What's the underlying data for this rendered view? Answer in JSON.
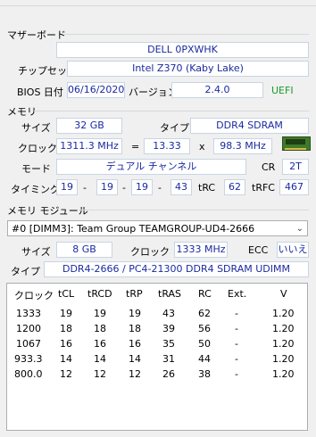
{
  "motherboard": {
    "title": "マザーボード",
    "model": "DELL 0PXWHK",
    "chipset_label": "チップセット",
    "chipset": "Intel Z370 (Kaby Lake)",
    "bios_label": "BIOS 日付",
    "bios_date": "06/16/2020",
    "version_label": "バージョン",
    "version": "2.4.0",
    "uefi": "UEFI"
  },
  "memory": {
    "title": "メモリ",
    "size_label": "サイズ",
    "size": "32 GB",
    "type_label": "タイプ",
    "type": "DDR4 SDRAM",
    "clock_label": "クロック",
    "clock": "1311.3 MHz",
    "eq": "=",
    "multiplier": "13.33",
    "x": "x",
    "bus": "98.3 MHz",
    "mode_label": "モード",
    "mode": "デュアル チャンネル",
    "cr_label": "CR",
    "cr": "2T",
    "timing_label": "タイミング",
    "t1": "19",
    "t2": "19",
    "t3": "19",
    "t4": "43",
    "dash": "-",
    "trc_label": "tRC",
    "trc": "62",
    "trfc_label": "tRFC",
    "trfc": "467"
  },
  "module": {
    "title": "メモリ モジュール",
    "selected": "#0 [DIMM3]: Team Group TEAMGROUP-UD4-2666",
    "size_label": "サイズ",
    "size": "8 GB",
    "clock_label": "クロック",
    "clock": "1333 MHz",
    "ecc_label": "ECC",
    "ecc": "いいえ",
    "type_label": "タイプ",
    "type": "DDR4-2666 / PC4-21300 DDR4 SDRAM UDIMM"
  },
  "table": {
    "headers": [
      "クロック",
      "tCL",
      "tRCD",
      "tRP",
      "tRAS",
      "RC",
      "Ext.",
      "V"
    ],
    "rows": [
      [
        "1333",
        "19",
        "19",
        "19",
        "43",
        "62",
        "-",
        "1.20"
      ],
      [
        "1200",
        "18",
        "18",
        "18",
        "39",
        "56",
        "-",
        "1.20"
      ],
      [
        "1067",
        "16",
        "16",
        "16",
        "35",
        "50",
        "-",
        "1.20"
      ],
      [
        "933.3",
        "14",
        "14",
        "14",
        "31",
        "44",
        "-",
        "1.20"
      ],
      [
        "800.0",
        "12",
        "12",
        "12",
        "26",
        "38",
        "-",
        "1.20"
      ]
    ]
  },
  "icons": {
    "chip": "memory-chip-icon",
    "chevron": "chevron-down-icon"
  }
}
